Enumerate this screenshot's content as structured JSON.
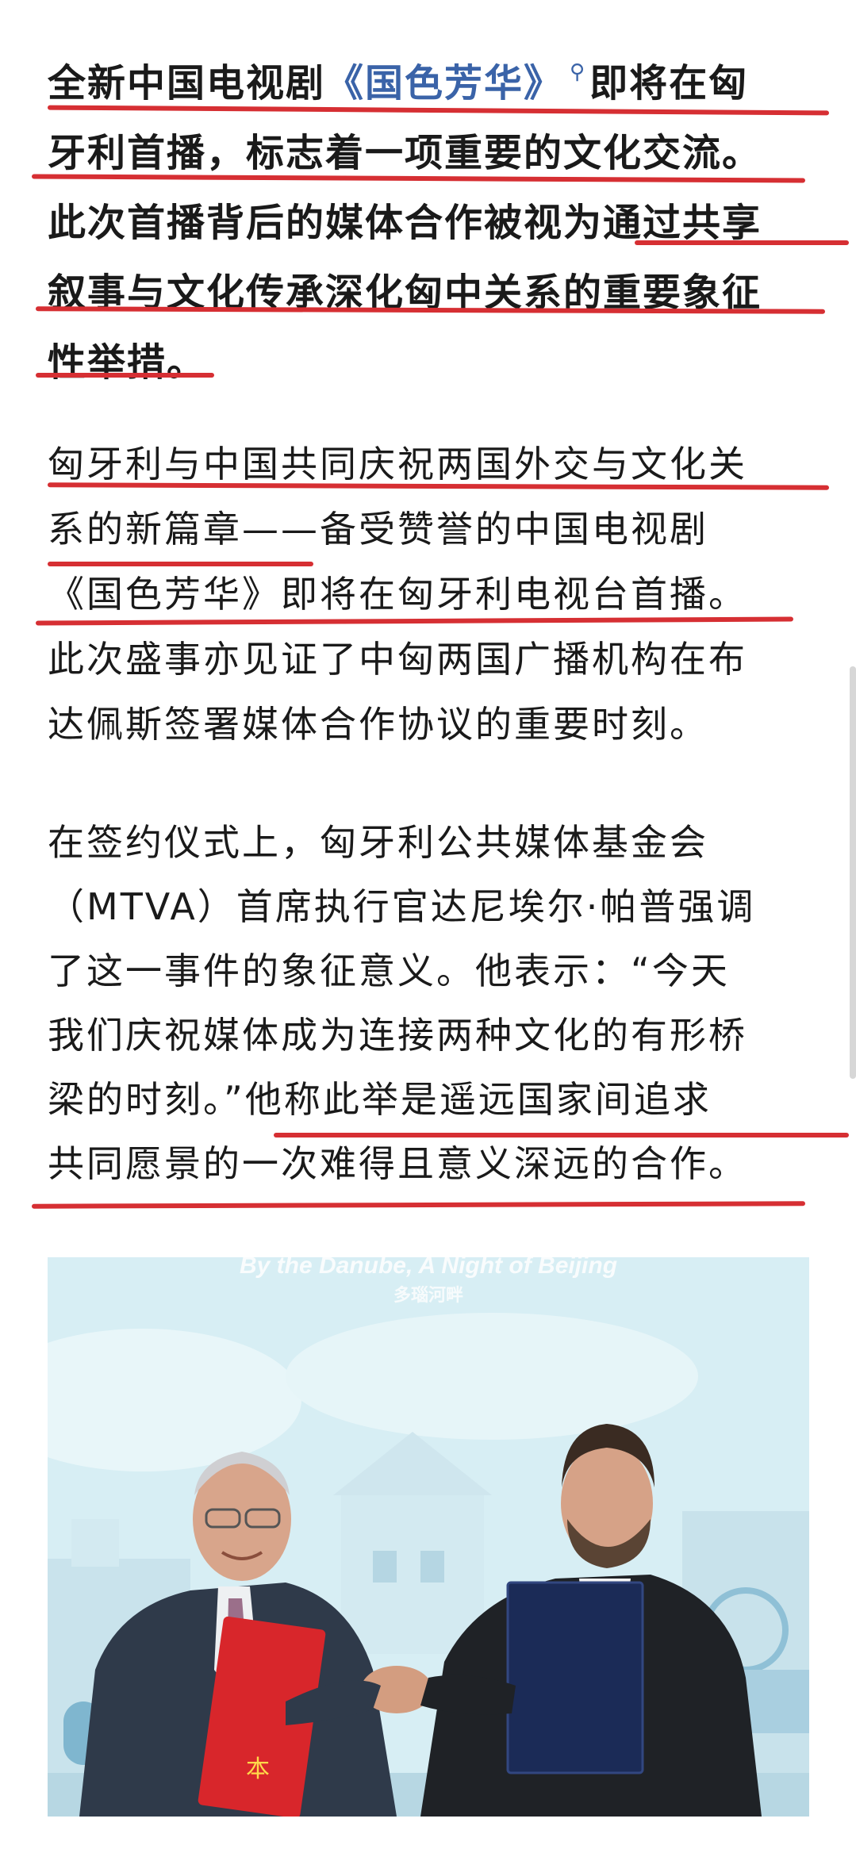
{
  "paragraph1": {
    "lines": [
      {
        "before": "全新中国电视剧",
        "link": "《国色芳华》",
        "after": "即将在匈"
      },
      {
        "text": "牙利首播，标志着一项重要的文化交流。"
      },
      {
        "text": "此次首播背后的媒体合作被视为通过共享"
      },
      {
        "text": "叙事与文化传承深化匈中关系的重要象征"
      },
      {
        "text": "性举措。"
      }
    ]
  },
  "paragraph2": {
    "lines": [
      "匈牙利与中国共同庆祝两国外交与文化关",
      "系的新篇章——备受赞誉的中国电视剧",
      "《国色芳华》即将在匈牙利电视台首播。",
      "此次盛事亦见证了中匈两国广播机构在布",
      "达佩斯签署媒体合作协议的重要时刻。"
    ]
  },
  "paragraph3": {
    "lines": [
      "在签约仪式上，匈牙利公共媒体基金会",
      "（MTVA）首席执行官达尼埃尔·帕普强调",
      "了这一事件的象征意义。他表示：“今天",
      "我们庆祝媒体成为连接两种文化的有形桥",
      "梁的时刻。”他称此举是遥远国家间追求",
      "共同愿景的一次难得且意义深远的合作。"
    ]
  },
  "photo": {
    "banner_en": "By the Danube, A Night of Beijing",
    "banner_cn": "多瑙河畔",
    "folder_left_text": "本"
  },
  "colors": {
    "underline": "#d62f33",
    "link": "#3a63a8",
    "text": "#1a1a1a"
  },
  "icons": {
    "search": "search-icon"
  }
}
